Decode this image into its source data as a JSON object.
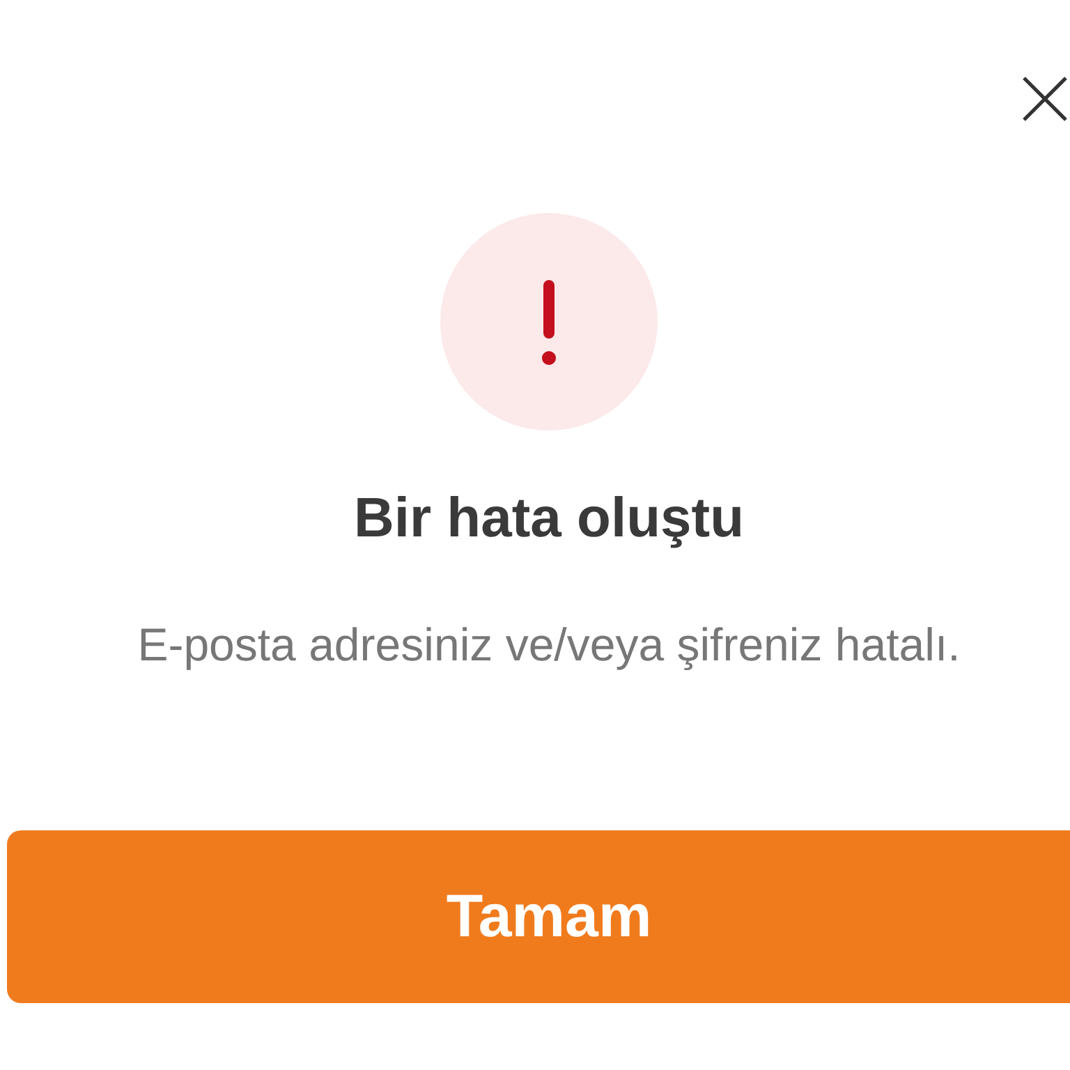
{
  "dialog": {
    "title": "Bir hata oluştu",
    "message": "E-posta adresiniz ve/veya şifreniz hatalı.",
    "buttons": [
      {
        "label": "Tamam",
        "kind": "primary"
      }
    ]
  }
}
